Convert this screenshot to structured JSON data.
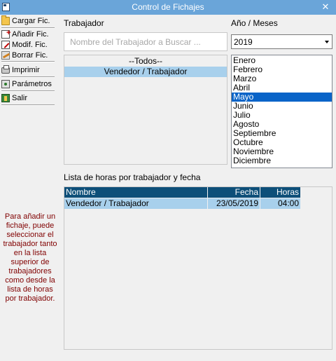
{
  "window": {
    "title": "Control de Fichajes",
    "close_glyph": "✕"
  },
  "toolbar": {
    "items": [
      {
        "label": "Cargar Fic.",
        "icon": "folder-icon"
      },
      {
        "label": "Añadir Fic.",
        "icon": "add-file-icon"
      },
      {
        "label": "Modif. Fic.",
        "icon": "edit-file-icon"
      },
      {
        "label": "Borrar Fic.",
        "icon": "eraser-icon"
      },
      {
        "label": "Imprimir",
        "icon": "printer-icon"
      },
      {
        "label": "Parámetros",
        "icon": "settings-icon"
      },
      {
        "label": "Salir",
        "icon": "exit-icon"
      }
    ]
  },
  "help_text": "Para añadir un fichaje, puede seleccionar el trabajador tanto en la lista superior de trabajadores como desde la lista de horas por trabajador.",
  "worker_section": {
    "label": "Trabajador",
    "search_placeholder": "Nombre del Trabajador a Buscar ...",
    "search_value": "",
    "items": [
      "--Todos--",
      "Vendedor / Trabajador"
    ],
    "selected_index": 1
  },
  "date_section": {
    "label": "Año / Meses",
    "year": "2019",
    "months": [
      "Enero",
      "Febrero",
      "Marzo",
      "Abril",
      "Mayo",
      "Junio",
      "Julio",
      "Agosto",
      "Septiembre",
      "Octubre",
      "Noviembre",
      "Diciembre"
    ],
    "selected_month": "Mayo"
  },
  "hours_section": {
    "label": "Lista de horas por trabajador y fecha",
    "columns": [
      "Nombre",
      "Fecha",
      "Horas"
    ],
    "rows": [
      {
        "nombre": "Vendedor / Trabajador",
        "fecha": "23/05/2019",
        "horas": "04:00"
      }
    ]
  },
  "colors": {
    "title_bar": "#6aa5d9",
    "selection_light": "#a8d0ec",
    "selection_dark": "#0a64c8",
    "table_header": "#0d4f79",
    "help_text": "#800000"
  }
}
